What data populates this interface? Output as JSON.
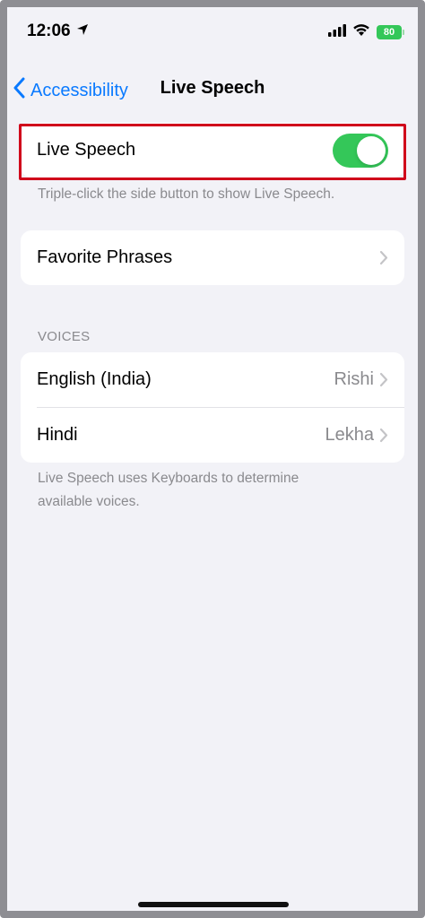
{
  "status_bar": {
    "time": "12:06",
    "battery": "80"
  },
  "nav": {
    "back_label": "Accessibility",
    "title": "Live Speech"
  },
  "live_speech": {
    "label": "Live Speech",
    "enabled": true,
    "footnote": "Triple-click the side button to show Live Speech."
  },
  "favorites": {
    "label": "Favorite Phrases"
  },
  "voices": {
    "header": "VOICES",
    "items": [
      {
        "label": "English (India)",
        "value": "Rishi"
      },
      {
        "label": "Hindi",
        "value": "Lekha"
      }
    ],
    "footnote_line1": "Live Speech uses Keyboards to determine",
    "footnote_line2": "available voices."
  },
  "colors": {
    "accent": "#0a7aff",
    "toggle_on": "#34c759",
    "highlight": "#d0021b"
  }
}
